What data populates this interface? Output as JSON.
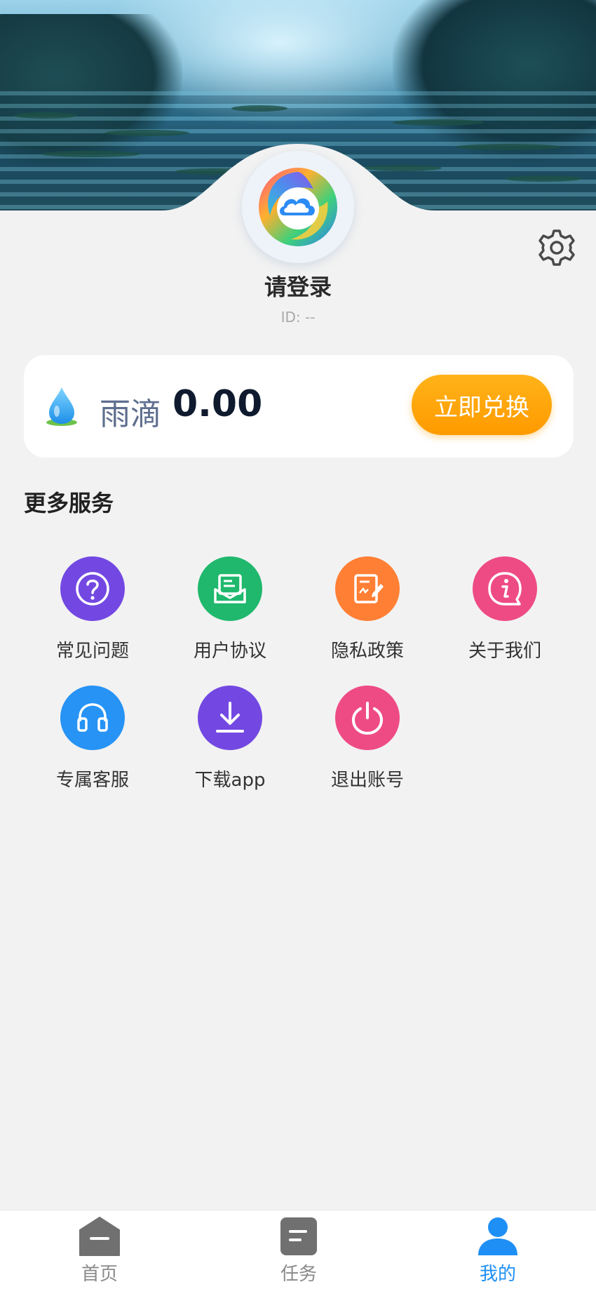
{
  "profile": {
    "login_prompt": "请登录",
    "user_id": "ID: --"
  },
  "wallet": {
    "currency_icon": "water-drop-icon",
    "currency_label": "雨滴",
    "balance": "0.00",
    "exchange_label": "立即兑换"
  },
  "services": {
    "title": "更多服务",
    "items": [
      {
        "label": "常见问题",
        "icon": "question-icon",
        "color": "#7348e2"
      },
      {
        "label": "用户协议",
        "icon": "agreement-icon",
        "color": "#1fb86d"
      },
      {
        "label": "隐私政策",
        "icon": "privacy-policy-icon",
        "color": "#ff7f35"
      },
      {
        "label": "关于我们",
        "icon": "info-icon",
        "color": "#ee4b85"
      },
      {
        "label": "专属客服",
        "icon": "headset-icon",
        "color": "#2693f5"
      },
      {
        "label": "下载app",
        "icon": "download-icon",
        "color": "#7348e2"
      },
      {
        "label": "退出账号",
        "icon": "power-icon",
        "color": "#ee4b85"
      }
    ]
  },
  "tabbar": {
    "items": [
      {
        "label": "首页",
        "icon": "home-icon"
      },
      {
        "label": "任务",
        "icon": "task-icon"
      },
      {
        "label": "我的",
        "icon": "user-icon"
      }
    ],
    "active_color": "#1e8ff5",
    "inactive_color": "#8a8a8a"
  }
}
